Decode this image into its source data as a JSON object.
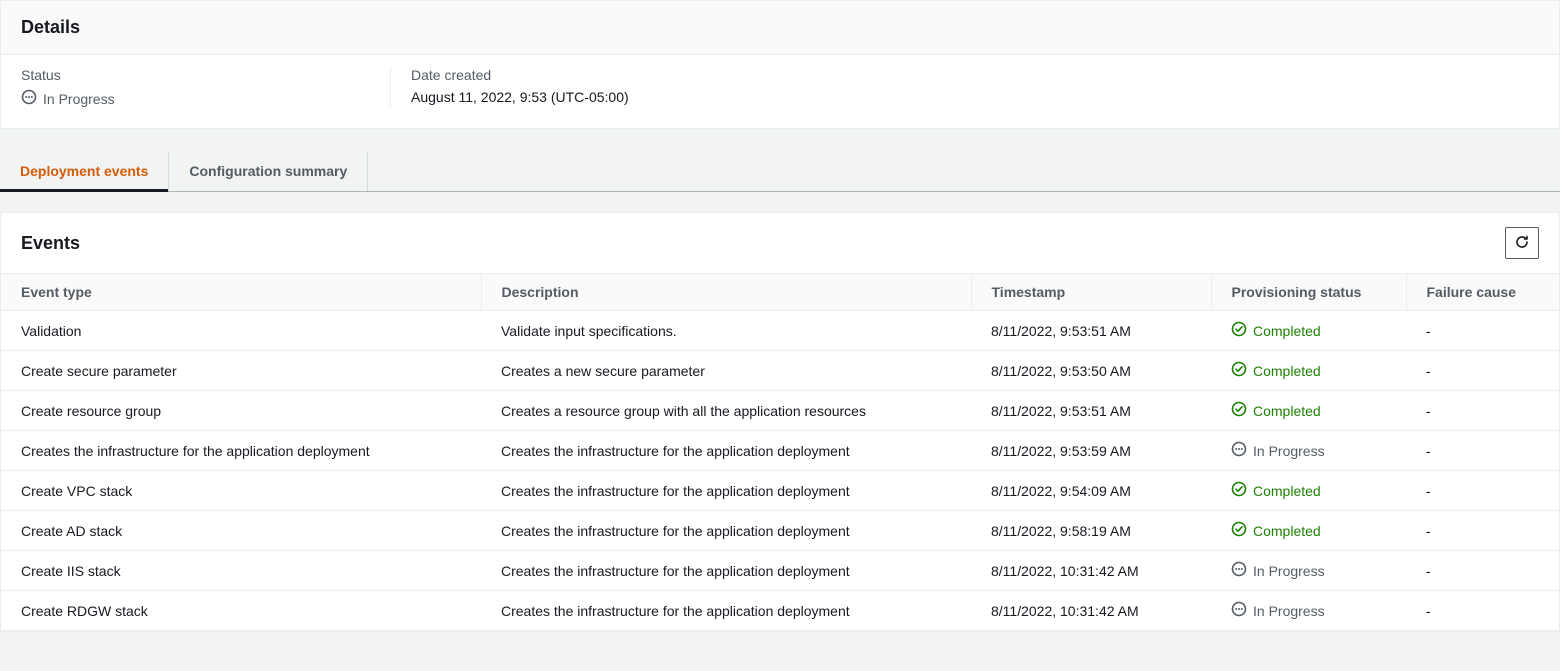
{
  "details": {
    "title": "Details",
    "status_label": "Status",
    "status_value": "In Progress",
    "date_label": "Date created",
    "date_value": "August 11, 2022, 9:53 (UTC-05:00)"
  },
  "tabs": [
    {
      "label": "Deployment events",
      "active": true
    },
    {
      "label": "Configuration summary",
      "active": false
    }
  ],
  "events": {
    "title": "Events",
    "columns": [
      "Event type",
      "Description",
      "Timestamp",
      "Provisioning status",
      "Failure cause"
    ],
    "rows": [
      {
        "type": "Validation",
        "desc": "Validate input specifications.",
        "time": "8/11/2022, 9:53:51 AM",
        "status": "Completed",
        "fail": "-"
      },
      {
        "type": "Create secure parameter",
        "desc": "Creates a new secure parameter",
        "time": "8/11/2022, 9:53:50 AM",
        "status": "Completed",
        "fail": "-"
      },
      {
        "type": "Create resource group",
        "desc": "Creates a resource group with all the application resources",
        "time": "8/11/2022, 9:53:51 AM",
        "status": "Completed",
        "fail": "-"
      },
      {
        "type": "Creates the infrastructure for the application deployment",
        "desc": "Creates the infrastructure for the application deployment",
        "time": "8/11/2022, 9:53:59 AM",
        "status": "In Progress",
        "fail": "-"
      },
      {
        "type": "Create VPC stack",
        "desc": "Creates the infrastructure for the application deployment",
        "time": "8/11/2022, 9:54:09 AM",
        "status": "Completed",
        "fail": "-"
      },
      {
        "type": "Create AD stack",
        "desc": "Creates the infrastructure for the application deployment",
        "time": "8/11/2022, 9:58:19 AM",
        "status": "Completed",
        "fail": "-"
      },
      {
        "type": "Create IIS stack",
        "desc": "Creates the infrastructure for the application deployment",
        "time": "8/11/2022, 10:31:42 AM",
        "status": "In Progress",
        "fail": "-"
      },
      {
        "type": "Create RDGW stack",
        "desc": "Creates the infrastructure for the application deployment",
        "time": "8/11/2022, 10:31:42 AM",
        "status": "In Progress",
        "fail": "-"
      }
    ]
  }
}
